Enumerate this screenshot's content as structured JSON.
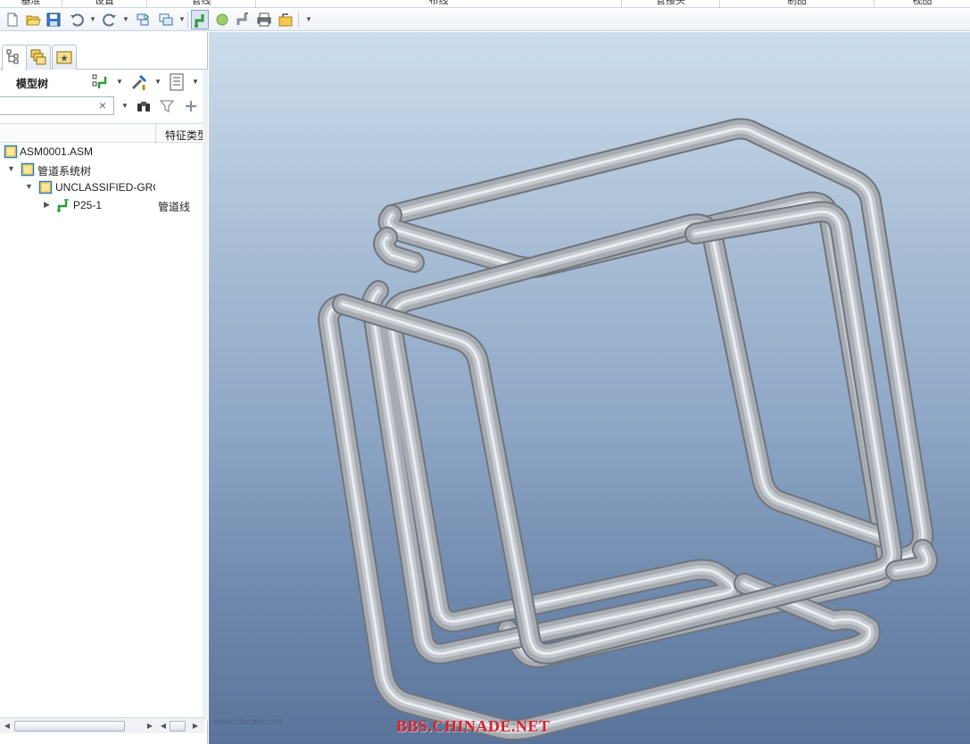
{
  "ribbon": {
    "tabs": [
      "基准",
      "设置",
      "管线",
      "布线",
      "管接头",
      "制图",
      "视图"
    ]
  },
  "quick_access": {
    "buttons": [
      "new-icon",
      "open-icon",
      "save-icon",
      "undo-icon",
      "redo-icon",
      "regenerate-icon",
      "window-icon",
      "pipeline-icon",
      "green-dot-icon",
      "pipe-mode-icon",
      "print-icon",
      "close-window-icon"
    ]
  },
  "panel": {
    "tabs": [
      "model-tree-tab",
      "layers-tab",
      "favorites-tab"
    ],
    "title": "模型树",
    "search": {
      "value": "",
      "clear_label": "×"
    },
    "column_feature_type": "特征类型"
  },
  "tree": {
    "items": [
      {
        "label": "ASM0001.ASM",
        "feature": "",
        "icon": "assembly-icon",
        "twisty": ""
      },
      {
        "label": "管道系统树",
        "feature": "",
        "icon": "assembly-icon",
        "twisty": "▼"
      },
      {
        "label": "UNCLASSIFIED-GROUP",
        "feature": "",
        "icon": "assembly-icon",
        "twisty": "▼"
      },
      {
        "label": "P25-1",
        "feature": "管道线",
        "icon": "pipeline-icon",
        "twisty": "▶"
      }
    ]
  },
  "viewport": {
    "watermark": "BBS.CHINADE.NET",
    "faint_text": "www.chinade.net"
  },
  "colors": {
    "viewport_top": "#cddded",
    "viewport_bottom": "#5a739a",
    "pipe": "#a7acb3",
    "watermark": "#d8202a"
  }
}
